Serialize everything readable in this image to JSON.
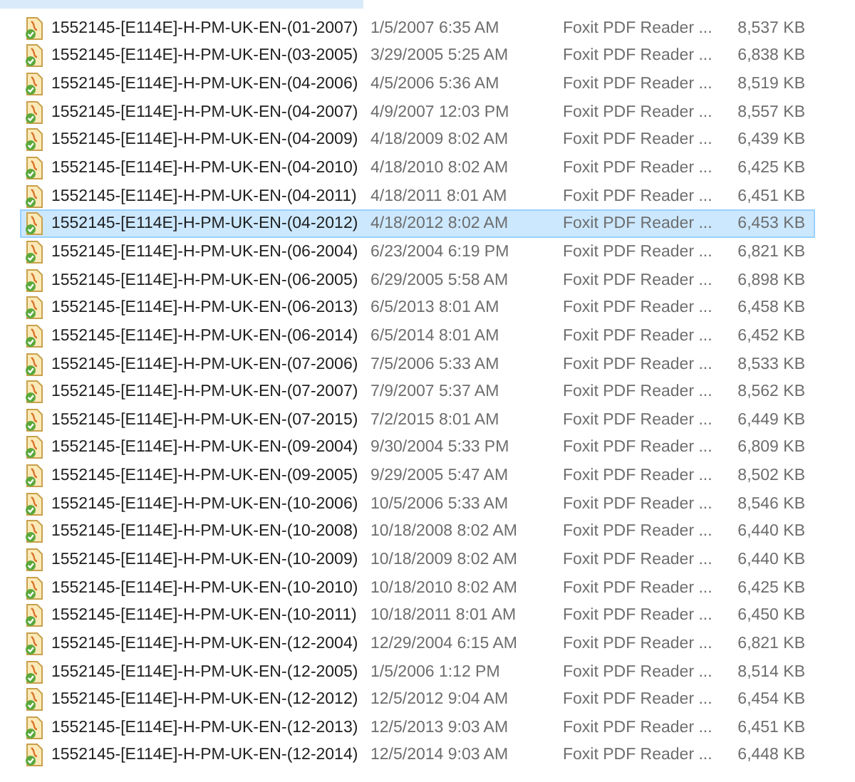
{
  "rows": [
    {
      "name": "1552145-[E114E]-H-PM-UK-EN-(01-2007)",
      "date": "1/5/2007 6:35 AM",
      "type": "Foxit PDF Reader ...",
      "size": "8,537 KB",
      "selected": false
    },
    {
      "name": "1552145-[E114E]-H-PM-UK-EN-(03-2005)",
      "date": "3/29/2005 5:25 AM",
      "type": "Foxit PDF Reader ...",
      "size": "6,838 KB",
      "selected": false
    },
    {
      "name": "1552145-[E114E]-H-PM-UK-EN-(04-2006)",
      "date": "4/5/2006 5:36 AM",
      "type": "Foxit PDF Reader ...",
      "size": "8,519 KB",
      "selected": false
    },
    {
      "name": "1552145-[E114E]-H-PM-UK-EN-(04-2007)",
      "date": "4/9/2007 12:03 PM",
      "type": "Foxit PDF Reader ...",
      "size": "8,557 KB",
      "selected": false
    },
    {
      "name": "1552145-[E114E]-H-PM-UK-EN-(04-2009)",
      "date": "4/18/2009 8:02 AM",
      "type": "Foxit PDF Reader ...",
      "size": "6,439 KB",
      "selected": false
    },
    {
      "name": "1552145-[E114E]-H-PM-UK-EN-(04-2010)",
      "date": "4/18/2010 8:02 AM",
      "type": "Foxit PDF Reader ...",
      "size": "6,425 KB",
      "selected": false
    },
    {
      "name": "1552145-[E114E]-H-PM-UK-EN-(04-2011)",
      "date": "4/18/2011 8:01 AM",
      "type": "Foxit PDF Reader ...",
      "size": "6,451 KB",
      "selected": false
    },
    {
      "name": "1552145-[E114E]-H-PM-UK-EN-(04-2012)",
      "date": "4/18/2012 8:02 AM",
      "type": "Foxit PDF Reader ...",
      "size": "6,453 KB",
      "selected": true
    },
    {
      "name": "1552145-[E114E]-H-PM-UK-EN-(06-2004)",
      "date": "6/23/2004 6:19 PM",
      "type": "Foxit PDF Reader ...",
      "size": "6,821 KB",
      "selected": false
    },
    {
      "name": "1552145-[E114E]-H-PM-UK-EN-(06-2005)",
      "date": "6/29/2005 5:58 AM",
      "type": "Foxit PDF Reader ...",
      "size": "6,898 KB",
      "selected": false
    },
    {
      "name": "1552145-[E114E]-H-PM-UK-EN-(06-2013)",
      "date": "6/5/2013 8:01 AM",
      "type": "Foxit PDF Reader ...",
      "size": "6,458 KB",
      "selected": false
    },
    {
      "name": "1552145-[E114E]-H-PM-UK-EN-(06-2014)",
      "date": "6/5/2014 8:01 AM",
      "type": "Foxit PDF Reader ...",
      "size": "6,452 KB",
      "selected": false
    },
    {
      "name": "1552145-[E114E]-H-PM-UK-EN-(07-2006)",
      "date": "7/5/2006 5:33 AM",
      "type": "Foxit PDF Reader ...",
      "size": "8,533 KB",
      "selected": false
    },
    {
      "name": "1552145-[E114E]-H-PM-UK-EN-(07-2007)",
      "date": "7/9/2007 5:37 AM",
      "type": "Foxit PDF Reader ...",
      "size": "8,562 KB",
      "selected": false
    },
    {
      "name": "1552145-[E114E]-H-PM-UK-EN-(07-2015)",
      "date": "7/2/2015 8:01 AM",
      "type": "Foxit PDF Reader ...",
      "size": "6,449 KB",
      "selected": false
    },
    {
      "name": "1552145-[E114E]-H-PM-UK-EN-(09-2004)",
      "date": "9/30/2004 5:33 PM",
      "type": "Foxit PDF Reader ...",
      "size": "6,809 KB",
      "selected": false
    },
    {
      "name": "1552145-[E114E]-H-PM-UK-EN-(09-2005)",
      "date": "9/29/2005 5:47 AM",
      "type": "Foxit PDF Reader ...",
      "size": "8,502 KB",
      "selected": false
    },
    {
      "name": "1552145-[E114E]-H-PM-UK-EN-(10-2006)",
      "date": "10/5/2006 5:33 AM",
      "type": "Foxit PDF Reader ...",
      "size": "8,546 KB",
      "selected": false
    },
    {
      "name": "1552145-[E114E]-H-PM-UK-EN-(10-2008)",
      "date": "10/18/2008 8:02 AM",
      "type": "Foxit PDF Reader ...",
      "size": "6,440 KB",
      "selected": false
    },
    {
      "name": "1552145-[E114E]-H-PM-UK-EN-(10-2009)",
      "date": "10/18/2009 8:02 AM",
      "type": "Foxit PDF Reader ...",
      "size": "6,440 KB",
      "selected": false
    },
    {
      "name": "1552145-[E114E]-H-PM-UK-EN-(10-2010)",
      "date": "10/18/2010 8:02 AM",
      "type": "Foxit PDF Reader ...",
      "size": "6,425 KB",
      "selected": false
    },
    {
      "name": "1552145-[E114E]-H-PM-UK-EN-(10-2011)",
      "date": "10/18/2011 8:01 AM",
      "type": "Foxit PDF Reader ...",
      "size": "6,450 KB",
      "selected": false
    },
    {
      "name": "1552145-[E114E]-H-PM-UK-EN-(12-2004)",
      "date": "12/29/2004 6:15 AM",
      "type": "Foxit PDF Reader ...",
      "size": "6,821 KB",
      "selected": false
    },
    {
      "name": "1552145-[E114E]-H-PM-UK-EN-(12-2005)",
      "date": "1/5/2006 1:12 PM",
      "type": "Foxit PDF Reader ...",
      "size": "8,514 KB",
      "selected": false
    },
    {
      "name": "1552145-[E114E]-H-PM-UK-EN-(12-2012)",
      "date": "12/5/2012 9:04 AM",
      "type": "Foxit PDF Reader ...",
      "size": "6,454 KB",
      "selected": false
    },
    {
      "name": "1552145-[E114E]-H-PM-UK-EN-(12-2013)",
      "date": "12/5/2013 9:03 AM",
      "type": "Foxit PDF Reader ...",
      "size": "6,451 KB",
      "selected": false
    },
    {
      "name": "1552145-[E114E]-H-PM-UK-EN-(12-2014)",
      "date": "12/5/2014 9:03 AM",
      "type": "Foxit PDF Reader ...",
      "size": "6,448 KB",
      "selected": false
    }
  ]
}
